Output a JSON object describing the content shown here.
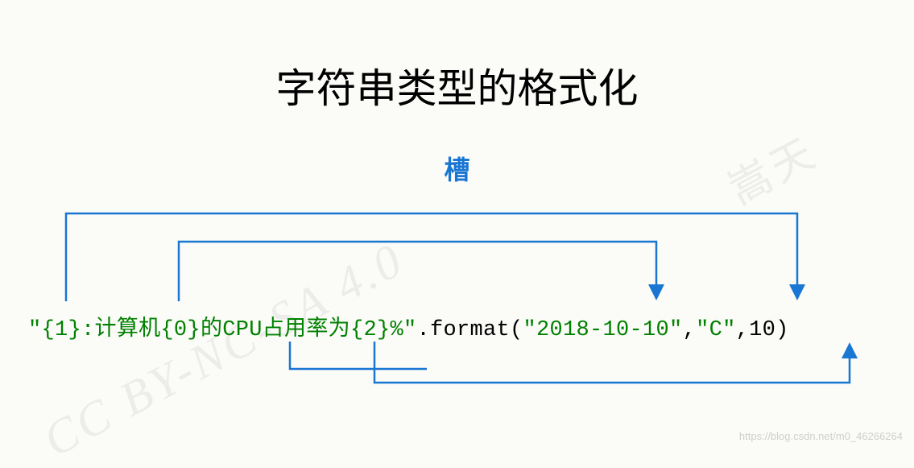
{
  "title": "字符串类型的格式化",
  "slot_label": "槽",
  "code": {
    "seg1": "\"{1}",
    "seg2": ":计算机",
    "seg3": "{0}",
    "seg4": "的CPU占用率为",
    "seg5": "{2}",
    "seg6": "%\"",
    "method": ".format(",
    "arg1": "\"2018-10-10\"",
    "comma1": ",",
    "arg2": "\"C\"",
    "comma2": ",",
    "arg3": "10",
    "close": ")"
  },
  "watermark": {
    "license": "CC BY-NC-SA 4.0",
    "author": "嵩天",
    "url": "https://blog.csdn.net/m0_46266264"
  },
  "arrows": {
    "comment": "Three bracket-arrows connecting slots {0},{1},{2} to format args; one open bracket from {2} down to arg3",
    "stroke": "#1976d2"
  }
}
